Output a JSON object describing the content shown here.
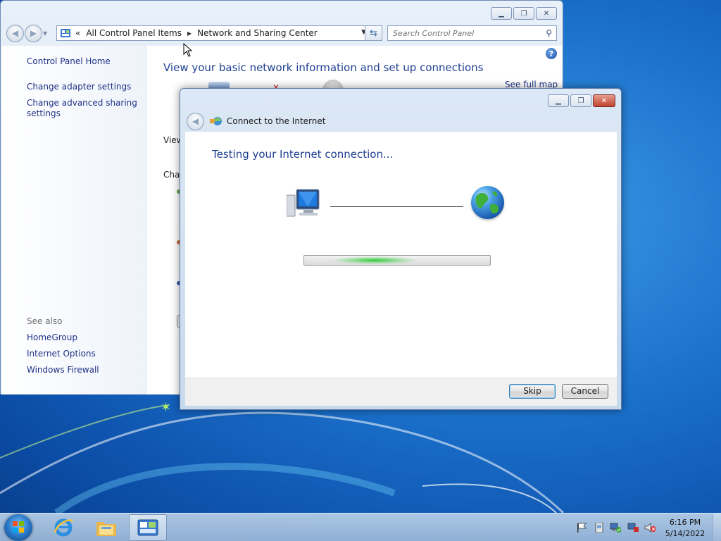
{
  "desktop": {},
  "control_panel": {
    "address": {
      "chevron": "«",
      "crumb1": "All Control Panel Items",
      "crumb2": "Network and Sharing Center"
    },
    "search": {
      "placeholder": "Search Control Panel"
    },
    "sidebar": {
      "home": "Control Panel Home",
      "adapter": "Change adapter settings",
      "advanced_line1": "Change advanced sharing",
      "advanced_line2": "settings",
      "see_also": "See also",
      "homegroup": "HomeGroup",
      "internet_options": "Internet Options",
      "firewall": "Windows Firewall"
    },
    "main": {
      "title": "View your basic network information and set up connections",
      "see_full_map": "See full map",
      "trunc_view": "View",
      "trunc_change": "Char"
    }
  },
  "dialog": {
    "title": "Connect to the Internet",
    "heading": "Testing your Internet connection...",
    "progress": {
      "state": "indeterminate",
      "accent": "#25c82d"
    },
    "skip": "Skip",
    "cancel": "Cancel"
  },
  "taskbar": {
    "pinned": [
      "internet-explorer-icon",
      "windows-explorer-icon",
      "control-panel-icon"
    ],
    "tray": [
      "action-center-flag-icon",
      "removable-media-icon",
      "network-status-icon",
      "power-icon",
      "volume-muted-icon"
    ],
    "clock": {
      "time": "6:16 PM",
      "date": "5/14/2022"
    }
  }
}
